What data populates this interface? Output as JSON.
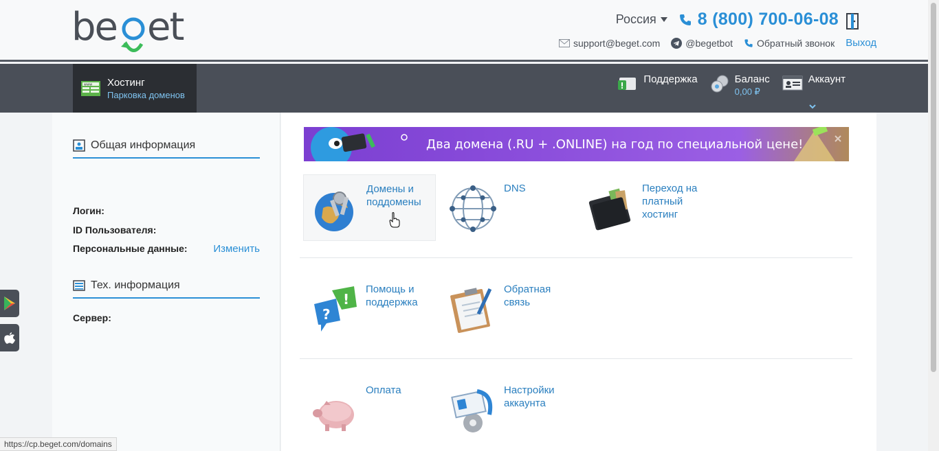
{
  "header": {
    "logo_text": "beget",
    "country": "Россия",
    "phone": "8 (800) 700-06-08",
    "support_email": "support@beget.com",
    "telegram": "@begetbot",
    "callback": "Обратный звонок",
    "logout": "Выход"
  },
  "nav": {
    "hosting_title": "Хостинг",
    "hosting_sub": "Парковка доменов",
    "support": "Поддержка",
    "balance_title": "Баланс",
    "balance_value": "0,00 ₽",
    "account": "Аккаунт"
  },
  "left": {
    "general_title": "Общая информация",
    "login_label": "Логин:",
    "user_id_label": "ID Пользователя:",
    "personal_label": "Персональные данные:",
    "personal_link": "Изменить",
    "tech_title": "Тех. информация",
    "server_label": "Сервер:"
  },
  "banner": {
    "text": "Два домена (.RU + .ONLINE) на год по специальной цене!"
  },
  "tiles": [
    {
      "label": "Домены и поддомены"
    },
    {
      "label": "DNS"
    },
    {
      "label": "Переход на платный хостинг"
    },
    {
      "label": "Помощь и поддержка"
    },
    {
      "label": "Обратная связь"
    },
    {
      "label": "Оплата"
    },
    {
      "label": "Настройки аккаунта"
    }
  ],
  "status_url": "https://cp.beget.com/domains",
  "colors": {
    "accent": "#2a8fd6",
    "nav_bg": "#4a4f58",
    "nav_active": "#2b2e33"
  }
}
